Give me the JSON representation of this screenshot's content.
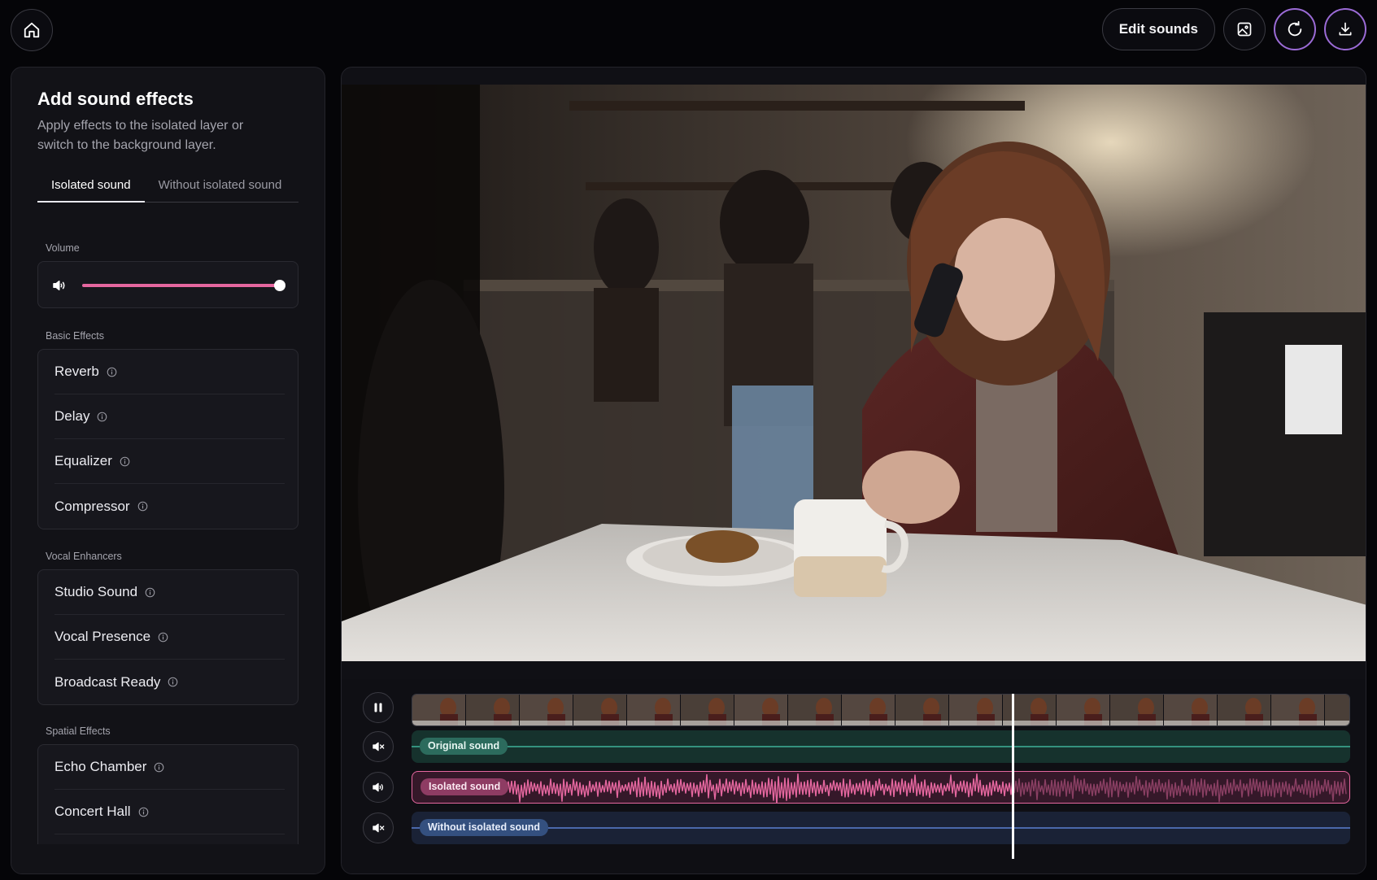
{
  "header": {
    "home_icon": "home-icon",
    "edit_sounds_label": "Edit sounds",
    "image_icon": "image-icon",
    "refresh_icon": "refresh-icon",
    "download_icon": "download-icon",
    "accent_color": "#9b6bd6"
  },
  "sidebar": {
    "title": "Add sound effects",
    "subtitle": "Apply effects to the isolated layer or switch to the background layer.",
    "tabs": [
      {
        "label": "Isolated sound",
        "active": true
      },
      {
        "label": "Without isolated sound",
        "active": false
      }
    ],
    "volume": {
      "label": "Volume",
      "icon": "speaker-icon",
      "value": 1.0,
      "fill_color": "#e5679f"
    },
    "sections": [
      {
        "label": "Basic Effects",
        "items": [
          {
            "label": "Reverb",
            "icon": "info-icon"
          },
          {
            "label": "Delay",
            "icon": "info-icon"
          },
          {
            "label": "Equalizer",
            "icon": "info-icon"
          },
          {
            "label": "Compressor",
            "icon": "info-icon"
          }
        ]
      },
      {
        "label": "Vocal Enhancers",
        "items": [
          {
            "label": "Studio Sound",
            "icon": "info-icon"
          },
          {
            "label": "Vocal Presence",
            "icon": "info-icon"
          },
          {
            "label": "Broadcast Ready",
            "icon": "info-icon"
          }
        ]
      },
      {
        "label": "Spatial Effects",
        "items": [
          {
            "label": "Echo Chamber",
            "icon": "info-icon"
          },
          {
            "label": "Concert Hall",
            "icon": "info-icon"
          }
        ]
      }
    ]
  },
  "player": {
    "play_state": "playing",
    "pause_icon": "pause-icon",
    "playhead_fraction": 0.64,
    "tracks": [
      {
        "label": "Original sound",
        "muted": true,
        "color": "#3fb29a"
      },
      {
        "label": "Isolated sound",
        "muted": false,
        "color": "#e5679f"
      },
      {
        "label": "Without isolated sound",
        "muted": true,
        "color": "#5b7fd1"
      }
    ]
  }
}
